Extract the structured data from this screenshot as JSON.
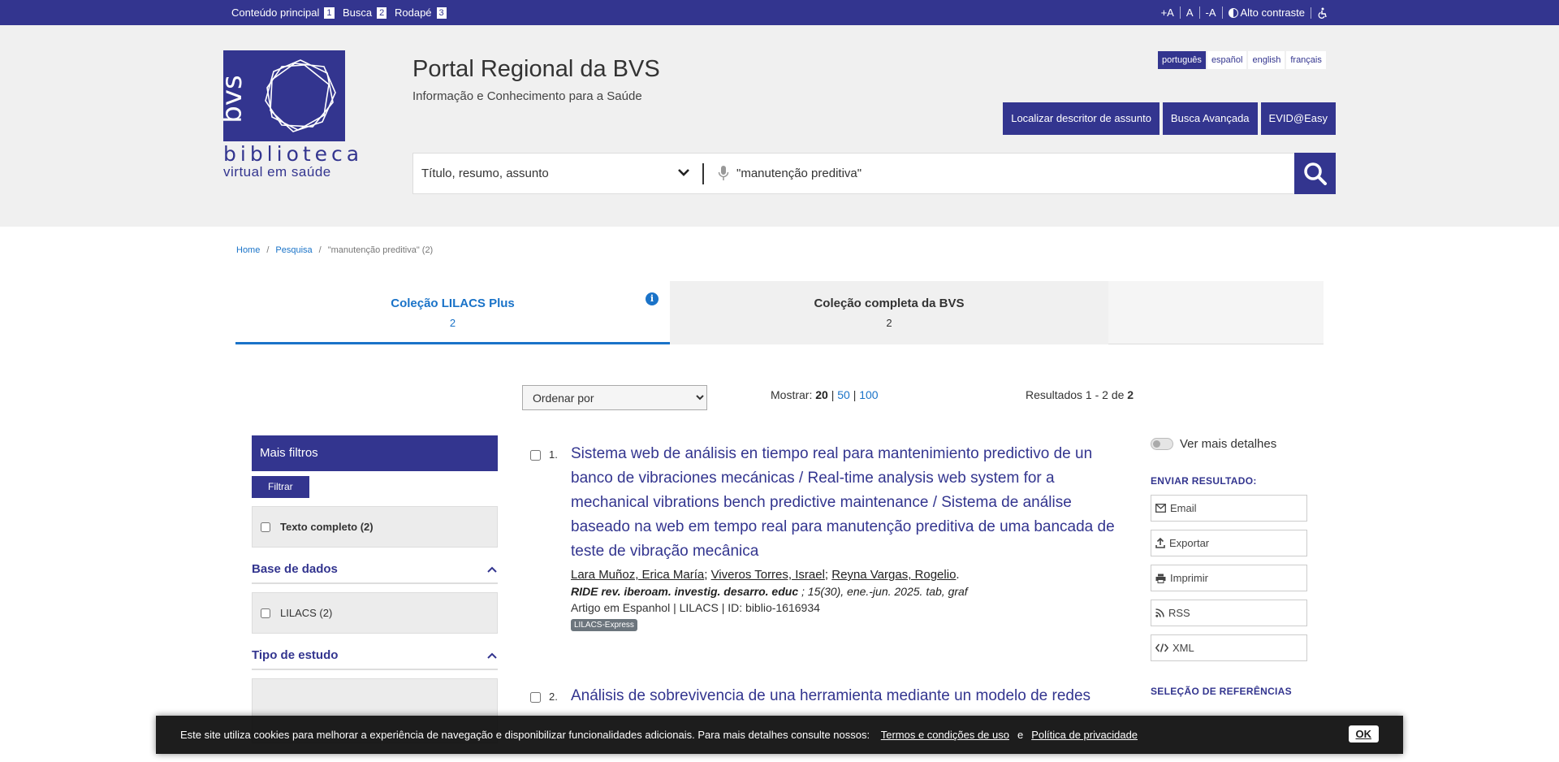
{
  "skip_links": [
    {
      "label": "Conteúdo principal",
      "key": "1"
    },
    {
      "label": "Busca",
      "key": "2"
    },
    {
      "label": "Rodapé",
      "key": "3"
    }
  ],
  "accessibility": {
    "font_increase": "+A",
    "font_normal": "A",
    "font_decrease": "-A",
    "contrast": "Alto contraste",
    "accessibility_icon": "wheelchair-icon"
  },
  "logo": {
    "line1": "biblioteca",
    "line2": "virtual em saúde",
    "mark": "bvs"
  },
  "site": {
    "title": "Portal Regional da BVS",
    "subtitle": "Informação e Conhecimento para a Saúde"
  },
  "languages": [
    {
      "label": "português",
      "active": true
    },
    {
      "label": "español",
      "active": false
    },
    {
      "label": "english",
      "active": false
    },
    {
      "label": "français",
      "active": false
    }
  ],
  "header_buttons": [
    "Localizar descritor de assunto",
    "Busca Avançada",
    "EVID@Easy"
  ],
  "search": {
    "field": "Título, resumo, assunto",
    "query": "\"manutenção preditiva\""
  },
  "breadcrumb": {
    "home": "Home",
    "search": "Pesquisa",
    "current": "\"manutenção preditiva\" (2)"
  },
  "tabs": [
    {
      "title": "Coleção LILACS Plus",
      "count": "2",
      "active": true
    },
    {
      "title": "Coleção completa da BVS",
      "count": "2",
      "active": false
    }
  ],
  "toolbar": {
    "sort_placeholder": "Ordenar por",
    "show_label": "Mostrar:",
    "show_current": "20",
    "show_opt1": "50",
    "show_opt2": "100",
    "results_label": "Resultados 1 - 2 de",
    "results_total": "2"
  },
  "filters": {
    "more_filters": "Mais filtros",
    "filter_button": "Filtrar",
    "full_text": "Texto completo (2)",
    "database_heading": "Base de dados",
    "database_item": "LILACS (2)",
    "study_type_heading": "Tipo de estudo"
  },
  "results": [
    {
      "index": "1.",
      "title": "Sistema web de análisis en tiempo real para mantenimiento predictivo de un banco de vibraciones mecánicas / Real-time analysis web system for a mechanical vibrations bench predictive maintenance / Sistema de análise baseado na web em tempo real para manutenção preditiva de uma bancada de teste de vibração mecânica",
      "authors": [
        "Lara Muñoz, Erica María",
        "Viveros Torres, Israel",
        "Reyna Vargas, Rogelio"
      ],
      "journal": "RIDE rev. iberoam. investig. desarro. educ",
      "source_rest": " ; 15(30), ene.-jun. 2025. tab, graf",
      "meta": "Artigo em Espanhol | LILACS | ID: biblio-1616934",
      "badge": "LILACS-Express"
    },
    {
      "index": "2.",
      "title": "Análisis de sobrevivencia de una herramienta mediante un modelo de redes"
    }
  ],
  "sidebar": {
    "details_toggle": "Ver mais detalhes",
    "send_heading": "ENVIAR RESULTADO:",
    "email": "Email",
    "export": "Exportar",
    "print": "Imprimir",
    "rss": "RSS",
    "xml": "XML",
    "refs_heading": "SELEÇÃO DE REFERÊNCIAS"
  },
  "cookie": {
    "text": "Este site utiliza cookies para melhorar a experiência de navegação e disponibilizar funcionalidades adicionais. Para mais detalhes consulte nossos:",
    "terms": "Termos e condições de uso",
    "and": "e",
    "privacy": "Política de privacidade",
    "ok": "OK"
  },
  "colors": {
    "brand": "#33358f",
    "link": "#1a73c8",
    "header_bg": "#f0f0f0"
  }
}
